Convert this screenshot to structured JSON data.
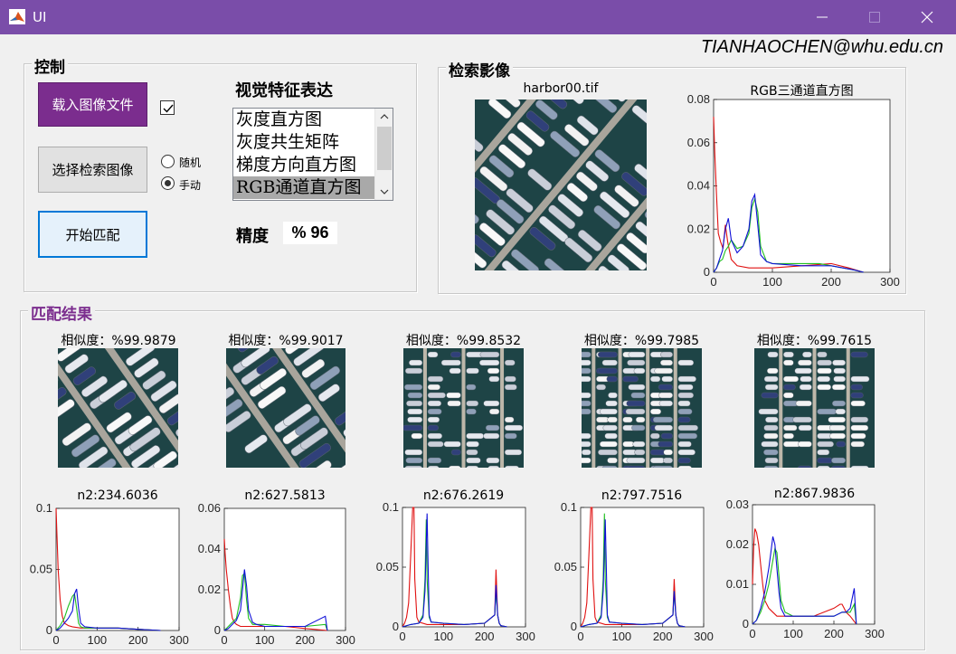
{
  "window": {
    "title": "UI"
  },
  "author": "TIANHAOCHEN@whu.edu.cn",
  "control": {
    "title": "控制",
    "load_button": "载入图像文件",
    "load_checkbox_checked": true,
    "select_button": "选择检索图像",
    "radio_random": "随机",
    "radio_manual": "手动",
    "radio_selected": "manual",
    "match_button": "开始匹配",
    "feature_label": "视觉特征表达",
    "features": [
      "灰度直方图",
      "灰度共生矩阵",
      "梯度方向直方图",
      "RGB通道直方图"
    ],
    "selected_feature_index": 3,
    "precision_label": "精度",
    "precision_value": "% 96"
  },
  "query": {
    "title": "检索影像",
    "image_title": "harbor00.tif",
    "chart_title": "RGB三通道直方图"
  },
  "results": {
    "title": "匹配结果",
    "items": [
      {
        "similarity": "相似度：%99.9879",
        "n2": "n2:234.6036"
      },
      {
        "similarity": "相似度：%99.9017",
        "n2": "n2:627.5813"
      },
      {
        "similarity": "相似度：%99.8532",
        "n2": "n2:676.2619"
      },
      {
        "similarity": "相似度：%99.7985",
        "n2": "n2:797.7516"
      },
      {
        "similarity": "相似度：%99.7615",
        "n2": "n2:867.9836"
      }
    ]
  },
  "colors": {
    "titlebar": "#7a4da9",
    "accent_purple": "#7b2d8e",
    "red": "#e01010",
    "green": "#1fbf1f",
    "blue": "#1010d8"
  },
  "chart_data": [
    {
      "type": "line",
      "title": "RGB三通道直方图",
      "xlim": [
        0,
        300
      ],
      "ylim": [
        0,
        0.08
      ],
      "xticks": [
        0,
        100,
        200,
        300
      ],
      "yticks": [
        0,
        0.02,
        0.04,
        0.06,
        0.08
      ],
      "ytick_labels": [
        "0",
        "0.02",
        "0.04",
        "0.06",
        "0.08"
      ],
      "series": [
        {
          "color": "red",
          "x": [
            0,
            2,
            5,
            8,
            12,
            16,
            20,
            24,
            30,
            40,
            60,
            100,
            150,
            200,
            230,
            255
          ],
          "y": [
            0.072,
            0.055,
            0.035,
            0.018,
            0.014,
            0.011,
            0.022,
            0.014,
            0.006,
            0.003,
            0.002,
            0.002,
            0.003,
            0.004,
            0.002,
            0
          ]
        },
        {
          "color": "green",
          "x": [
            0,
            5,
            10,
            15,
            20,
            25,
            30,
            40,
            50,
            60,
            65,
            70,
            75,
            80,
            90,
            100,
            150,
            180,
            200,
            220,
            240,
            255
          ],
          "y": [
            0,
            0.002,
            0.005,
            0.006,
            0.01,
            0.012,
            0.015,
            0.011,
            0.012,
            0.018,
            0.03,
            0.034,
            0.028,
            0.012,
            0.005,
            0.004,
            0.004,
            0.004,
            0.003,
            0.002,
            0.001,
            0
          ]
        },
        {
          "color": "blue",
          "x": [
            0,
            5,
            10,
            15,
            20,
            25,
            30,
            40,
            50,
            60,
            65,
            70,
            75,
            80,
            90,
            100,
            150,
            180,
            200,
            220,
            240,
            255
          ],
          "y": [
            0,
            0.002,
            0.006,
            0.01,
            0.02,
            0.025,
            0.015,
            0.009,
            0.012,
            0.02,
            0.033,
            0.036,
            0.022,
            0.008,
            0.005,
            0.004,
            0.003,
            0.003,
            0.003,
            0.002,
            0.001,
            0
          ]
        }
      ]
    },
    {
      "type": "line",
      "title": "n2:234.6036",
      "xlim": [
        0,
        300
      ],
      "ylim": [
        0,
        0.1
      ],
      "xticks": [
        0,
        100,
        200,
        300
      ],
      "yticks": [
        0,
        0.05,
        0.1
      ],
      "ytick_labels": [
        "0",
        "0.05",
        "0.1"
      ],
      "series": [
        {
          "color": "red",
          "x": [
            0,
            2,
            5,
            10,
            15,
            20,
            30,
            40,
            60,
            100,
            150,
            200,
            255
          ],
          "y": [
            0.1,
            0.08,
            0.05,
            0.025,
            0.012,
            0.006,
            0.004,
            0.003,
            0.002,
            0.002,
            0.002,
            0.001,
            0
          ]
        },
        {
          "color": "green",
          "x": [
            0,
            10,
            20,
            30,
            40,
            45,
            50,
            55,
            60,
            70,
            100,
            150,
            200,
            255
          ],
          "y": [
            0,
            0.004,
            0.01,
            0.02,
            0.028,
            0.03,
            0.018,
            0.006,
            0.003,
            0.002,
            0.002,
            0.002,
            0.001,
            0
          ]
        },
        {
          "color": "blue",
          "x": [
            0,
            10,
            20,
            30,
            40,
            45,
            50,
            55,
            60,
            70,
            100,
            150,
            200,
            255
          ],
          "y": [
            0,
            0.002,
            0.006,
            0.01,
            0.016,
            0.03,
            0.034,
            0.018,
            0.006,
            0.003,
            0.002,
            0.002,
            0.001,
            0
          ]
        }
      ]
    },
    {
      "type": "line",
      "title": "n2:627.5813",
      "xlim": [
        0,
        300
      ],
      "ylim": [
        0,
        0.06
      ],
      "xticks": [
        0,
        100,
        200,
        300
      ],
      "yticks": [
        0,
        0.02,
        0.04,
        0.06
      ],
      "ytick_labels": [
        "0",
        "0.02",
        "0.04",
        "0.06"
      ],
      "series": [
        {
          "color": "red",
          "x": [
            0,
            2,
            5,
            10,
            15,
            20,
            25,
            30,
            40,
            60,
            100,
            150,
            200,
            255
          ],
          "y": [
            0.045,
            0.038,
            0.03,
            0.02,
            0.012,
            0.006,
            0.004,
            0.003,
            0.002,
            0.002,
            0.002,
            0.002,
            0.001,
            0
          ]
        },
        {
          "color": "green",
          "x": [
            0,
            10,
            20,
            30,
            40,
            45,
            50,
            55,
            60,
            70,
            80,
            100,
            150,
            200,
            250,
            255
          ],
          "y": [
            0,
            0.002,
            0.004,
            0.006,
            0.016,
            0.027,
            0.028,
            0.015,
            0.006,
            0.003,
            0.003,
            0.003,
            0.002,
            0.002,
            0.003,
            0
          ]
        },
        {
          "color": "blue",
          "x": [
            0,
            10,
            20,
            30,
            40,
            45,
            50,
            55,
            60,
            70,
            80,
            100,
            150,
            200,
            250,
            255
          ],
          "y": [
            0,
            0.001,
            0.003,
            0.005,
            0.01,
            0.02,
            0.03,
            0.022,
            0.01,
            0.004,
            0.003,
            0.002,
            0.002,
            0.002,
            0.007,
            0
          ]
        }
      ]
    },
    {
      "type": "line",
      "title": "n2:676.2619",
      "xlim": [
        0,
        300
      ],
      "ylim": [
        0,
        0.1
      ],
      "xticks": [
        0,
        100,
        200,
        300
      ],
      "yticks": [
        0,
        0.05,
        0.1
      ],
      "ytick_labels": [
        "0",
        "0.05",
        "0.1"
      ],
      "series": [
        {
          "color": "red",
          "x": [
            0,
            5,
            10,
            15,
            20,
            25,
            28,
            30,
            35,
            40,
            60,
            100,
            150,
            200,
            225,
            228,
            232,
            236,
            240,
            255
          ],
          "y": [
            0,
            0.003,
            0.008,
            0.02,
            0.06,
            0.1,
            0.1,
            0.04,
            0.008,
            0.004,
            0.002,
            0.002,
            0.002,
            0.003,
            0.01,
            0.048,
            0.01,
            0.003,
            0.001,
            0
          ]
        },
        {
          "color": "green",
          "x": [
            0,
            20,
            40,
            50,
            55,
            58,
            60,
            65,
            70,
            100,
            150,
            200,
            225,
            228,
            232,
            236,
            240,
            255
          ],
          "y": [
            0,
            0.002,
            0.003,
            0.01,
            0.04,
            0.09,
            0.04,
            0.008,
            0.004,
            0.003,
            0.002,
            0.003,
            0.01,
            0.03,
            0.01,
            0.003,
            0.001,
            0
          ]
        },
        {
          "color": "blue",
          "x": [
            0,
            20,
            40,
            50,
            55,
            60,
            62,
            65,
            70,
            100,
            150,
            200,
            225,
            228,
            232,
            236,
            240,
            255
          ],
          "y": [
            0,
            0.002,
            0.003,
            0.008,
            0.03,
            0.095,
            0.06,
            0.01,
            0.004,
            0.003,
            0.002,
            0.003,
            0.01,
            0.035,
            0.01,
            0.003,
            0.001,
            0
          ]
        }
      ]
    },
    {
      "type": "line",
      "title": "n2:797.7516",
      "xlim": [
        0,
        300
      ],
      "ylim": [
        0,
        0.1
      ],
      "xticks": [
        0,
        100,
        200,
        300
      ],
      "yticks": [
        0,
        0.05,
        0.1
      ],
      "ytick_labels": [
        "0",
        "0.05",
        "0.1"
      ],
      "series": [
        {
          "color": "red",
          "x": [
            0,
            5,
            10,
            15,
            20,
            25,
            28,
            30,
            35,
            40,
            60,
            100,
            150,
            200,
            225,
            228,
            232,
            236,
            240,
            255
          ],
          "y": [
            0,
            0.003,
            0.008,
            0.02,
            0.06,
            0.1,
            0.1,
            0.04,
            0.008,
            0.004,
            0.002,
            0.002,
            0.002,
            0.003,
            0.01,
            0.04,
            0.01,
            0.003,
            0.001,
            0
          ]
        },
        {
          "color": "green",
          "x": [
            0,
            20,
            40,
            50,
            55,
            58,
            60,
            65,
            70,
            100,
            150,
            200,
            225,
            228,
            232,
            236,
            240,
            255
          ],
          "y": [
            0,
            0.002,
            0.003,
            0.01,
            0.04,
            0.095,
            0.04,
            0.008,
            0.004,
            0.003,
            0.002,
            0.003,
            0.01,
            0.03,
            0.01,
            0.003,
            0.001,
            0
          ]
        },
        {
          "color": "blue",
          "x": [
            0,
            20,
            40,
            50,
            55,
            60,
            62,
            65,
            70,
            100,
            150,
            200,
            225,
            228,
            232,
            236,
            240,
            255
          ],
          "y": [
            0,
            0.002,
            0.003,
            0.008,
            0.03,
            0.09,
            0.06,
            0.01,
            0.004,
            0.003,
            0.002,
            0.003,
            0.01,
            0.03,
            0.01,
            0.003,
            0.001,
            0
          ]
        }
      ]
    },
    {
      "type": "line",
      "title": "n2:867.9836",
      "xlim": [
        0,
        300
      ],
      "ylim": [
        0,
        0.03
      ],
      "xticks": [
        0,
        100,
        200,
        300
      ],
      "yticks": [
        0,
        0.01,
        0.02,
        0.03
      ],
      "ytick_labels": [
        "0",
        "0.01",
        "0.02",
        "0.03"
      ],
      "series": [
        {
          "color": "red",
          "x": [
            0,
            3,
            6,
            10,
            15,
            20,
            25,
            30,
            40,
            50,
            60,
            100,
            150,
            200,
            215,
            220,
            225,
            230,
            240,
            255
          ],
          "y": [
            0.01,
            0.02,
            0.024,
            0.023,
            0.02,
            0.015,
            0.01,
            0.006,
            0.004,
            0.003,
            0.002,
            0.002,
            0.002,
            0.004,
            0.005,
            0.005,
            0.004,
            0.003,
            0.002,
            0
          ]
        },
        {
          "color": "green",
          "x": [
            0,
            10,
            20,
            30,
            40,
            50,
            55,
            60,
            65,
            70,
            80,
            100,
            150,
            200,
            220,
            230,
            240,
            250,
            255
          ],
          "y": [
            0,
            0.001,
            0.003,
            0.006,
            0.01,
            0.016,
            0.019,
            0.018,
            0.012,
            0.006,
            0.003,
            0.002,
            0.002,
            0.002,
            0.003,
            0.003,
            0.003,
            0.005,
            0
          ]
        },
        {
          "color": "blue",
          "x": [
            0,
            10,
            20,
            30,
            40,
            45,
            50,
            55,
            60,
            65,
            70,
            80,
            100,
            150,
            200,
            220,
            230,
            240,
            250,
            255
          ],
          "y": [
            0,
            0.001,
            0.004,
            0.008,
            0.014,
            0.018,
            0.022,
            0.02,
            0.014,
            0.008,
            0.004,
            0.002,
            0.002,
            0.002,
            0.002,
            0.003,
            0.003,
            0.004,
            0.009,
            0
          ]
        }
      ]
    }
  ]
}
